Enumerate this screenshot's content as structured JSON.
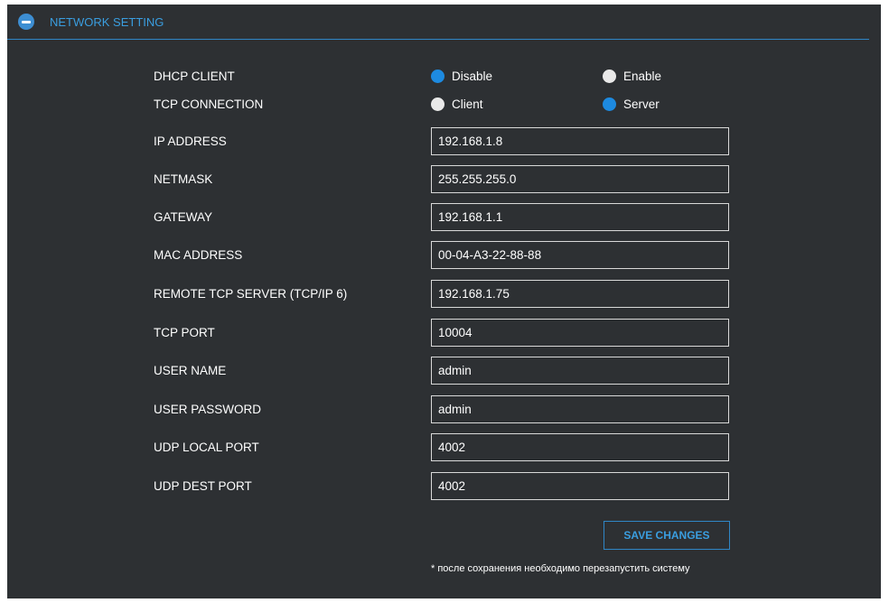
{
  "header": {
    "title": "NETWORK SETTING",
    "icon": "minus-circle-icon",
    "accent": "#3a9ee0"
  },
  "dhcp": {
    "label": "DHCP CLIENT",
    "options": [
      {
        "label": "Disable",
        "selected": true
      },
      {
        "label": "Enable",
        "selected": false
      }
    ]
  },
  "tcp_connection": {
    "label": "TCP CONNECTION",
    "options": [
      {
        "label": "Client",
        "selected": false
      },
      {
        "label": "Server",
        "selected": true
      }
    ]
  },
  "fields": [
    {
      "label": "IP ADDRESS",
      "value": "192.168.1.8"
    },
    {
      "label": "NETMASK",
      "value": "255.255.255.0"
    },
    {
      "label": "GATEWAY",
      "value": "192.168.1.1"
    },
    {
      "label": "MAC ADDRESS",
      "value": "00-04-A3-22-88-88"
    },
    {
      "label": "REMOTE TCP SERVER (TCP/IP 6)",
      "value": "192.168.1.75"
    },
    {
      "label": "TCP PORT",
      "value": "10004"
    },
    {
      "label": "USER NAME",
      "value": "admin"
    },
    {
      "label": "USER PASSWORD",
      "value": "admin"
    },
    {
      "label": "UDP LOCAL PORT",
      "value": "4002"
    },
    {
      "label": "UDP DEST PORT",
      "value": "4002"
    }
  ],
  "save_label": "SAVE CHANGES",
  "note": "* после сохранения необходимо перезапустить систему"
}
